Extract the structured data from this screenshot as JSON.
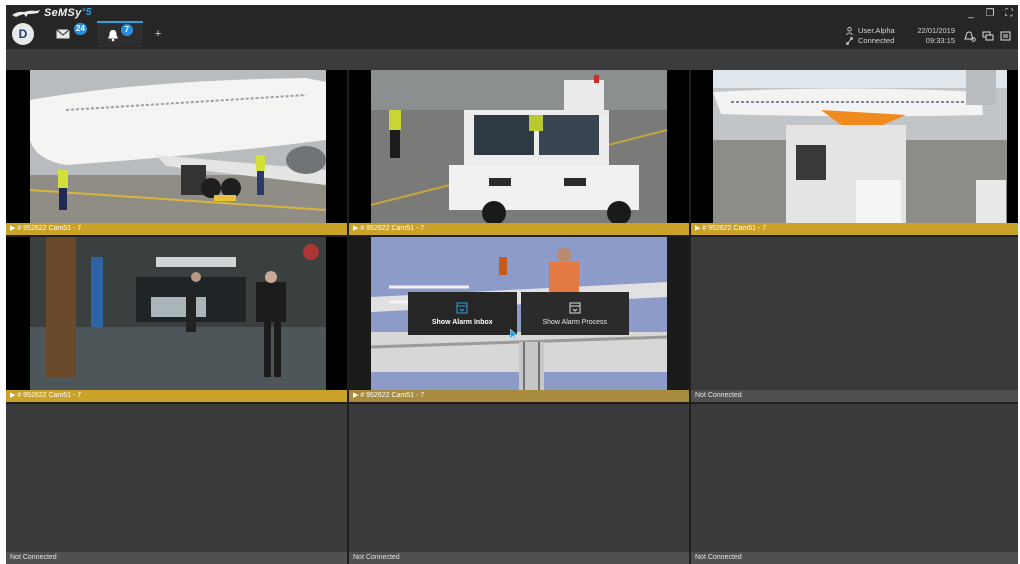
{
  "app": {
    "brand": "SeMSy",
    "version": "5"
  },
  "tabs": {
    "home_letter": "D",
    "messages_badge": "24",
    "alarms_badge": "7",
    "add_label": "+"
  },
  "status": {
    "user": "User.Alpha",
    "connection": "Connected",
    "date": "22/01/2019",
    "time": "09:33:15"
  },
  "window_controls": [
    "_",
    "❐",
    "⛶",
    "✕"
  ],
  "cameras": [
    {
      "label": "▶ # 952622  Cam51 - 7",
      "state": "live",
      "scene": "airplane-worker"
    },
    {
      "label": "▶ # 952622  Cam51 - 7",
      "state": "live",
      "scene": "tug-vehicle"
    },
    {
      "label": "▶ # 952622  Cam51 - 7",
      "state": "live",
      "scene": "apron"
    },
    {
      "label": "▶ # 952622  Cam51 - 7",
      "state": "live",
      "scene": "terminal"
    },
    {
      "label": "▶ # 952622  Cam51 - 7",
      "state": "selected",
      "scene": "gantry"
    },
    {
      "label": "Not Connected",
      "state": "offline"
    },
    {
      "label": "Not Connected",
      "state": "offline"
    },
    {
      "label": "Not Connected",
      "state": "offline"
    },
    {
      "label": "Not Connected",
      "state": "offline"
    }
  ],
  "context_menu": {
    "inbox_label": "Show Alarm Inbox",
    "process_label": "Show Alarm Process"
  },
  "colors": {
    "accent": "#2aa3df",
    "label_gold": "#c9a227",
    "badge": "#2a8fd8"
  }
}
